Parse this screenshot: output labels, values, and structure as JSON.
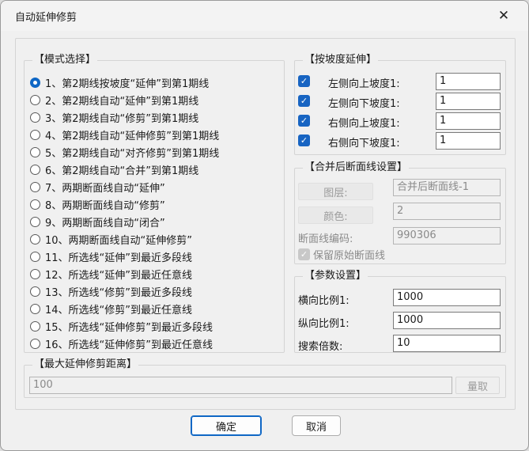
{
  "window": {
    "title": "自动延伸修剪",
    "close_glyph": "✕"
  },
  "mode": {
    "legend": "【模式选择】",
    "options": [
      {
        "label": "1、第2期线按坡度“延伸”到第1期线",
        "checked": true
      },
      {
        "label": "2、第2期线自动“延伸”到第1期线",
        "checked": false
      },
      {
        "label": "3、第2期线自动“修剪”到第1期线",
        "checked": false
      },
      {
        "label": "4、第2期线自动“延伸修剪”到第1期线",
        "checked": false
      },
      {
        "label": "5、第2期线自动“对齐修剪”到第1期线",
        "checked": false
      },
      {
        "label": "6、第2期线自动“合并”到第1期线",
        "checked": false
      },
      {
        "label": "7、两期断面线自动“延伸”",
        "checked": false
      },
      {
        "label": "8、两期断面线自动“修剪”",
        "checked": false
      },
      {
        "label": "9、两期断面线自动“闭合”",
        "checked": false
      },
      {
        "label": "10、两期断面线自动“延伸修剪”",
        "checked": false
      },
      {
        "label": "11、所选线“延伸”到最近多段线",
        "checked": false
      },
      {
        "label": "12、所选线“延伸”到最近任意线",
        "checked": false
      },
      {
        "label": "13、所选线“修剪”到最近多段线",
        "checked": false
      },
      {
        "label": "14、所选线“修剪”到最近任意线",
        "checked": false
      },
      {
        "label": "15、所选线“延伸修剪”到最近多段线",
        "checked": false
      },
      {
        "label": "16、所选线“延伸修剪”到最近任意线",
        "checked": false
      }
    ]
  },
  "slope": {
    "legend": "【按坡度延伸】",
    "rows": [
      {
        "label": "左侧向上坡度1:",
        "value": "1",
        "checked": true
      },
      {
        "label": "左侧向下坡度1:",
        "value": "1",
        "checked": true
      },
      {
        "label": "右侧向上坡度1:",
        "value": "1",
        "checked": true
      },
      {
        "label": "右侧向下坡度1:",
        "value": "1",
        "checked": true
      }
    ]
  },
  "merge": {
    "legend": "【合并后断面线设置】",
    "layer_button": "图层:",
    "layer_value": "合并后断面线-1",
    "color_button": "颜色:",
    "color_value": "2",
    "code_label": "断面线编码:",
    "code_value": "990306",
    "keep_label": "保留原始断面线",
    "keep_checked": true
  },
  "params": {
    "legend": "【参数设置】",
    "rows": [
      {
        "label": "横向比例1:",
        "value": "1000"
      },
      {
        "label": "纵向比例1:",
        "value": "1000"
      },
      {
        "label": "搜索倍数:",
        "value": "10"
      }
    ]
  },
  "maxdist": {
    "legend": "【最大延伸修剪距离】",
    "value": "100",
    "measure_button": "量取"
  },
  "footer": {
    "ok": "确定",
    "cancel": "取消"
  }
}
